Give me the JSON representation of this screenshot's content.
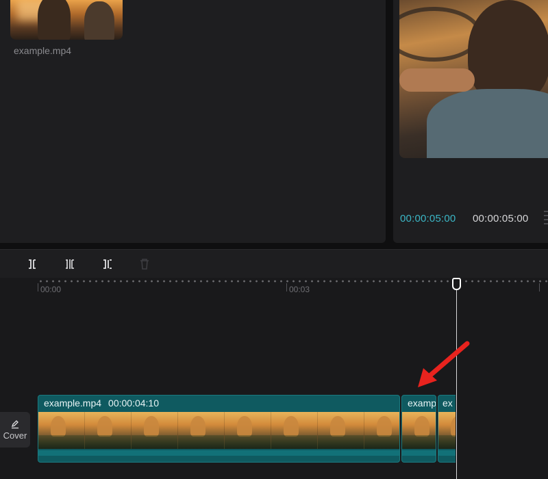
{
  "media": {
    "file_name": "example.mp4"
  },
  "player": {
    "current_time": "00:00:05:00",
    "total_time": "00:00:05:00"
  },
  "toolbar": {
    "tools": [
      "split-left-icon",
      "split-icon",
      "split-right-icon",
      "delete-icon"
    ]
  },
  "timeline": {
    "ruler_labels": [
      "00:00",
      "00:03"
    ],
    "cover_label": "Cover",
    "clips": [
      {
        "name": "example.mp4",
        "duration": "00:00:04:10"
      },
      {
        "name": "examp"
      },
      {
        "name": "ex"
      }
    ]
  },
  "annotation": {
    "arrow_color": "#e8231e"
  },
  "colors": {
    "accent_time": "#3bb7c6",
    "clip_fill": "#0f5a60"
  }
}
